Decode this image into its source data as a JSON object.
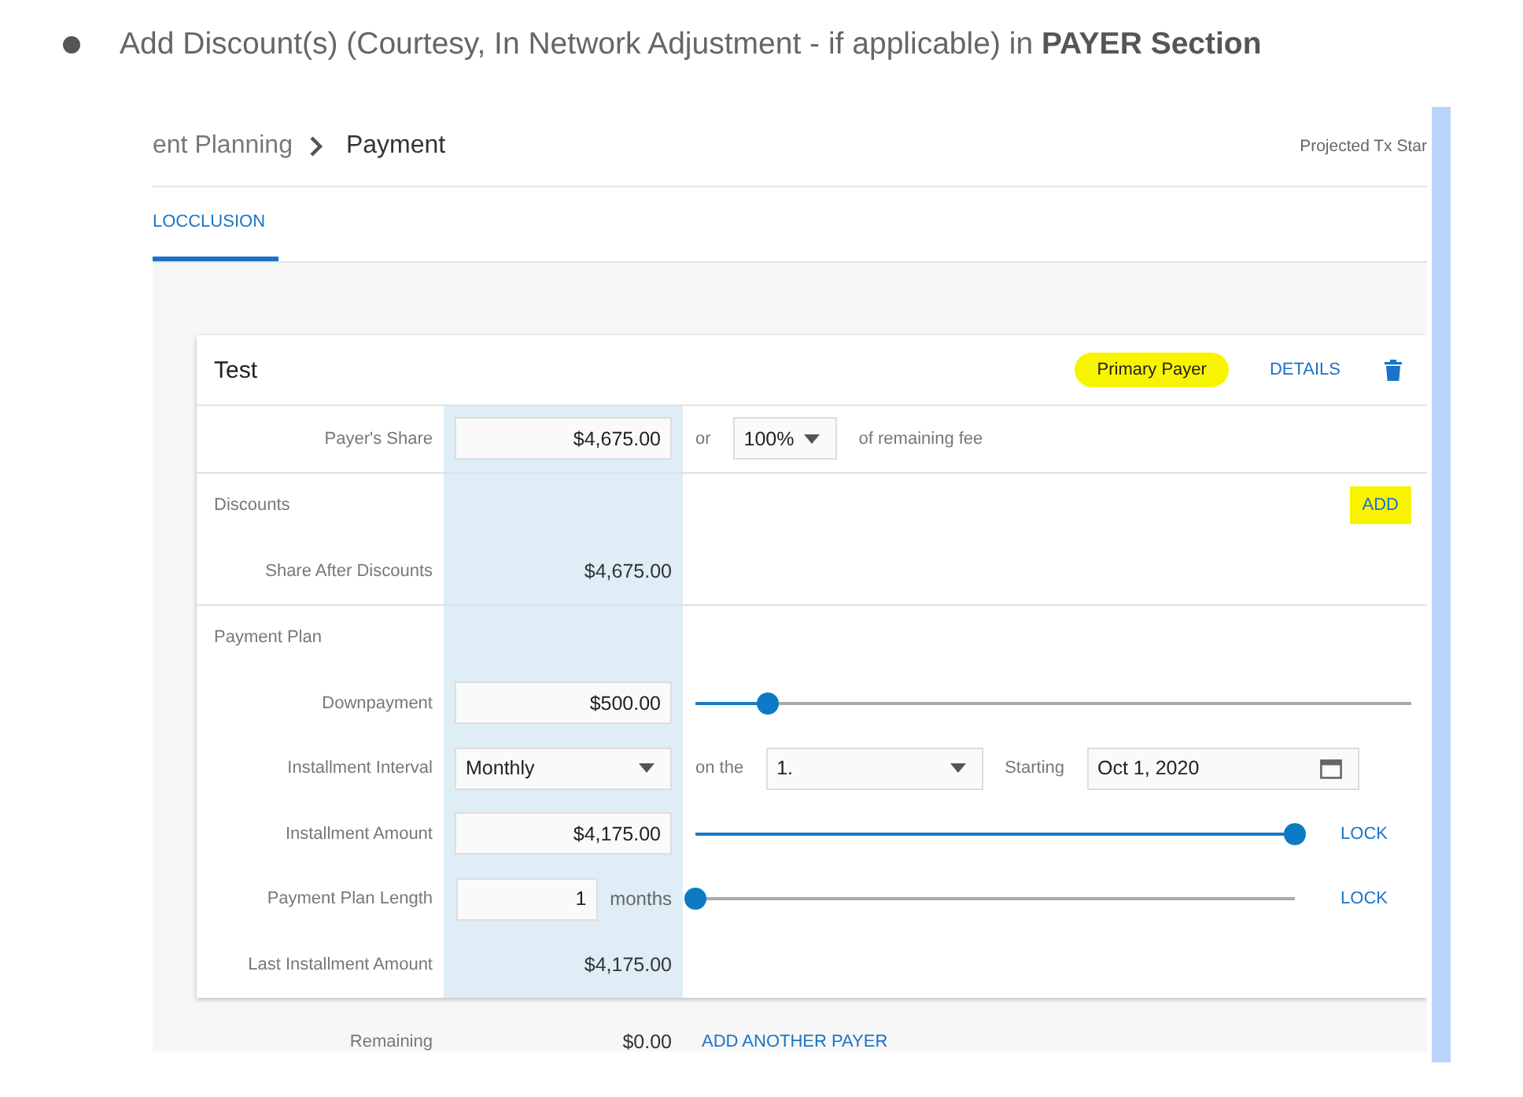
{
  "instruction": {
    "text": "Add Discount(s) (Courtesy, In Network Adjustment - if applicable) in **PAYER Section**"
  },
  "header": {
    "breadcrumb_parent": "ent Planning",
    "breadcrumb_current": "Payment",
    "projected": "Projected Tx Star"
  },
  "tabs": [
    {
      "label": "LOCCLUSION",
      "selected": true
    }
  ],
  "payer": {
    "name": "Test",
    "badge": {
      "label": "Primary Payer",
      "highlighted": true
    },
    "details": "DETAILS",
    "sections": [
      [
        {
          "kind": "share",
          "label": "Payer's Share",
          "value": "$4,675.00",
          "connector": "or",
          "percent": "100%",
          "suffix": "of remaining fee"
        }
      ],
      [
        {
          "kind": "section",
          "label": "Discounts",
          "action": "ADD",
          "highlighted": true
        },
        {
          "kind": "value",
          "label": "Share After Discounts",
          "value": "$4,675.00"
        }
      ],
      [
        {
          "kind": "section",
          "label": "Payment Plan"
        },
        {
          "kind": "slider",
          "label": "Downpayment",
          "value": "$500.00",
          "level": 0.1
        },
        {
          "kind": "interval",
          "label": "Installment Interval",
          "value": "Monthly",
          "connector": "on the",
          "day": "1.",
          "start_label": "Starting",
          "start": "Oct 1, 2020"
        },
        {
          "kind": "slider",
          "label": "Installment Amount",
          "value": "$4,175.00",
          "level": 1,
          "action": "LOCK"
        },
        {
          "kind": "slider",
          "label": "Payment Plan Length",
          "value": "1",
          "unit": "months",
          "level": 0,
          "action": "LOCK"
        },
        {
          "kind": "value",
          "label": "Last Installment Amount",
          "value": "$4,175.00"
        }
      ]
    ]
  },
  "footer": {
    "label": "Remaining",
    "value": "$0.00",
    "action": "ADD ANOTHER PAYER"
  }
}
